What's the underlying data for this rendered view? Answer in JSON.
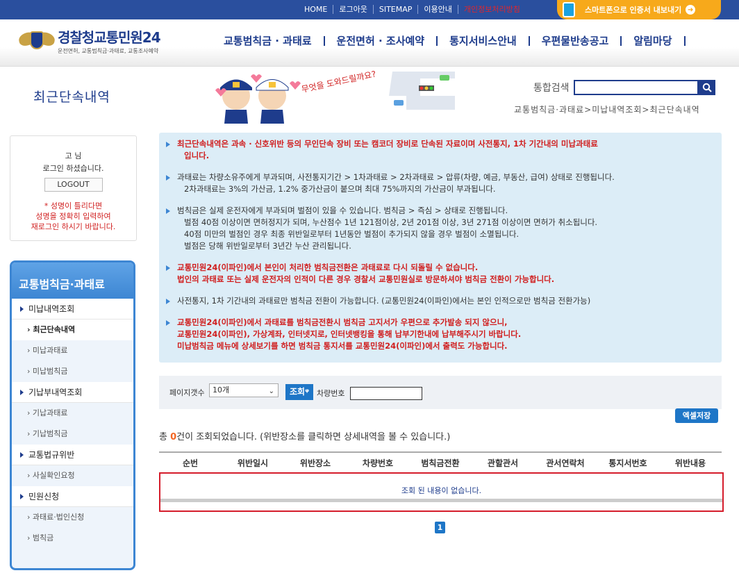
{
  "topnav": [
    "HOME",
    "로그아웃",
    "SITEMAP",
    "이용안내",
    "개인정보처리방침"
  ],
  "app_button": "스마트폰으로 인증서 내보내기",
  "logo": {
    "title_a": "경찰청",
    "title_b": "교통민원24",
    "subtitle": "운전면허, 교통범칙금·과태료, 교통조사예약"
  },
  "gnb": [
    "교통범칙금 · 과태료",
    "운전면허 · 조사예약",
    "통지서비스안내",
    "우편물반송공고",
    "알림마당"
  ],
  "page_title": "최근단속내역",
  "illust_text": "무엇을 도와드릴까요?",
  "search": {
    "label": "통합검색",
    "value": ""
  },
  "breadcrumb": "교통범칙금·과태료>미납내역조회>최근단속내역",
  "login": {
    "name": "고  님",
    "status": "로그인 하셨습니다.",
    "logout": "LOGOUT",
    "warning": "* 성명이 틀리다면\n성명을 정확히 입력하여\n재로그인 하시기 바랍니다."
  },
  "sidebar": {
    "title": "교통범칙금·과태료",
    "items": [
      {
        "label": "미납내역조회",
        "level": 1
      },
      {
        "label": "최근단속내역",
        "level": 2,
        "current": true
      },
      {
        "label": "미납과태료",
        "level": 2
      },
      {
        "label": "미납범칙금",
        "level": 2
      },
      {
        "label": "기납부내역조회",
        "level": 1
      },
      {
        "label": "기납과태료",
        "level": 2
      },
      {
        "label": "기납범칙금",
        "level": 2
      },
      {
        "label": "교통법규위반",
        "level": 1
      },
      {
        "label": "사실확인요청",
        "level": 2
      },
      {
        "label": "민원신청",
        "level": 1
      },
      {
        "label": "과태료·법인신청",
        "level": 2
      },
      {
        "label": "범칙금",
        "level": 2
      }
    ]
  },
  "notice": [
    {
      "red": true,
      "lines": [
        "최근단속내역은 과속 · 신호위반 등의 무인단속 장비 또는 캠코더 장비로 단속된 자료이며 사전통지, 1차 기간내의 미납과태료",
        "입니다."
      ]
    },
    {
      "red": false,
      "lines": [
        "과태료는 차량소유주에게 부과되며, 사전통지기간 > 1차과태료 > 2차과태료 > 압류(차량, 예금, 부동산, 급여) 상태로 진행됩니다.",
        "2차과태료는 3%의 가산금, 1.2% 중가산금이 붙으며 최대 75%까지의 가산금이 부과됩니다."
      ]
    },
    {
      "red": false,
      "lines": [
        "범칙금은 실제 운전자에게 부과되며 벌점이 있을 수 있습니다. 범칙금 > 즉심 > 상태로 진행됩니다.",
        "벌점 40점 이상이면 면허정지가 되며, 누산점수 1년 121점이상, 2년 201점 이상, 3년 271점 이상이면 면허가 취소됩니다.",
        "40점 미만의 벌점인 경우 최종 위반일로부터 1년동안 벌점이 추가되지 않을 경우 벌점이 소멸됩니다.",
        "벌점은 당해 위반일로부터 3년간 누산 관리됩니다."
      ]
    },
    {
      "red": true,
      "lines": [
        "교통민원24(이파인)에서 본인이 처리한 범칙금전환은 과태료로 다시 되돌릴 수 없습니다.",
        "법인의 과태료 또는 실제 운전자의 인적이 다른 경우 경찰서 교통민원실로 방문하셔야 범칙금 전환이 가능합니다."
      ]
    },
    {
      "red": false,
      "lines": [
        "사전통지, 1차 기간내의 과태료만 범칙금 전환이 가능합니다. (교통민원24(이파인)에서는 본인 인적으로만 범칙금 전환가능)"
      ]
    },
    {
      "red": true,
      "lines": [
        "교통민원24(이파인)에서 과태료를 범칙금전환시 범칙금 고지서가 우편으로 추가발송 되지 않으니,",
        "교통민원24(이파인), 가상계좌, 인터넷지로, 인터넷뱅킹을 통해 납부기한내에 납부해주시기 바랍니다.",
        "미납범칙금 메뉴에 상세보기를 하면 범칙금 통지서를 교통민원24(이파인)에서 출력도 가능합니다."
      ]
    }
  ],
  "controls": {
    "page_size_label": "페이지갯수",
    "page_size": "10개",
    "query_button": "조회",
    "plate_label": "차량번호",
    "plate_value": ""
  },
  "excel_button": "엑셀저장",
  "result": {
    "prefix": "총 ",
    "count": "0",
    "suffix": "건이 조회되었습니다. (위반장소를 클릭하면 상세내역을 볼 수 있습니다.)"
  },
  "table": {
    "headers": [
      "순번",
      "위반일시",
      "위반장소",
      "차량번호",
      "범칙금전환",
      "관할관서",
      "관서연락처",
      "통지서번호",
      "위반내용"
    ],
    "empty_message": "조회 된 내용이 없습니다."
  },
  "pagination": [
    "1"
  ],
  "colors": {
    "brand": "#1e3c8c",
    "accent": "#3d86d3",
    "alert": "#d01f1f",
    "orange": "#f7a91b"
  }
}
